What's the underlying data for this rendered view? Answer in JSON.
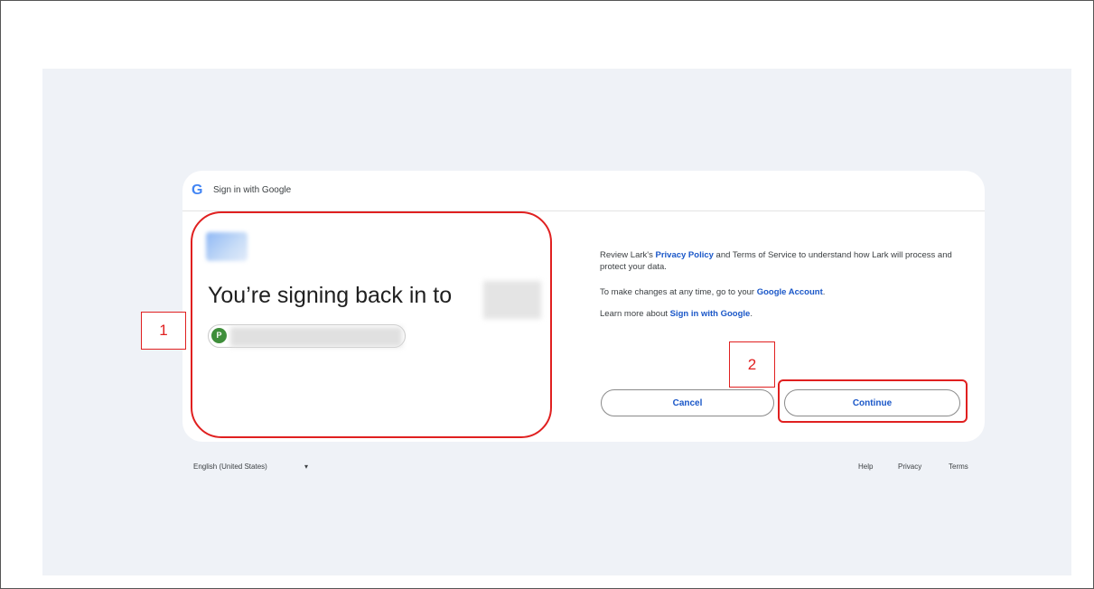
{
  "header": {
    "title": "Sign in with Google",
    "logo_letter": "G"
  },
  "left_panel": {
    "heading": "You’re signing back in to",
    "account_initial": "P"
  },
  "right_panel": {
    "privacy_prefix": "Review Lark's ",
    "privacy_link": "Privacy Policy",
    "privacy_suffix": " and Terms of Service to understand how Lark will process and protect your data.",
    "changes_prefix": "To make changes at any time, go to your ",
    "changes_link": "Google Account",
    "changes_suffix": ".",
    "learn_prefix": "Learn more about ",
    "learn_link": "Sign in with Google",
    "learn_suffix": "."
  },
  "buttons": {
    "cancel": "Cancel",
    "continue": "Continue"
  },
  "footer": {
    "language": "English (United States)",
    "caret": "▾",
    "help": "Help",
    "privacy": "Privacy",
    "terms": "Terms"
  },
  "annotations": {
    "label_1": "1",
    "label_2": "2",
    "color": "#e02020"
  },
  "colors": {
    "link": "#1a57c8",
    "backdrop": "#eff2f7",
    "avatar": "#3e8e3a"
  }
}
